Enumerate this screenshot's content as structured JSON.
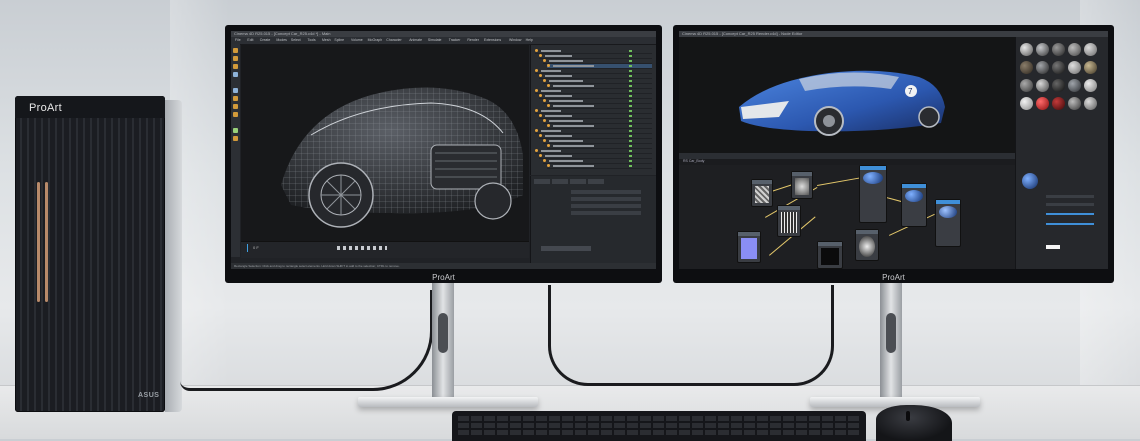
{
  "scene": {
    "tower": {
      "brand": "ProArt",
      "logo": "ASUS",
      "colors": {
        "body": "#1b1d22",
        "accent_slot": "#b88a6a",
        "side": "#c4c7cb"
      }
    },
    "monitor_left": {
      "bezel_logo": "ProArt",
      "app_title": "Cinema 4D R25.015 - [Concept Car_R25.c4d *] - Main",
      "menu_items": [
        "File",
        "Edit",
        "Create",
        "Modes",
        "Select",
        "Tools",
        "Mesh",
        "Spline",
        "Volume",
        "MoGraph",
        "Character",
        "Animate",
        "Simulate",
        "Tracker",
        "Render",
        "Extensions",
        "Window",
        "Help"
      ],
      "status_text": "Rectangle Selection: Click and drag to rectangle select elements. Hold down SHIFT to add to the selection; CTRL to remove.",
      "frame_readout": "0 F",
      "viewport_subject": "wireframe-car",
      "colors": {
        "ui_dark": "#202226",
        "accent": "#d29a3a",
        "tree_dot": "#e3a33e"
      }
    },
    "monitor_right": {
      "bezel_logo": "ProArt",
      "app_title": "Cinema 4D R25.015 - [Concept Car_R25 Render.c4d] - Node Editor",
      "viewport_subject": "rendered-blue-car",
      "car_number": "7",
      "node_panel_title": "RS Car_Body",
      "colors": {
        "car_body": "#2f5fbf",
        "wire": "#e2c66a",
        "node": "#3a3d43",
        "accent": "#3f8fd8"
      }
    },
    "peripherals": {
      "keyboard": "keyboard-icon",
      "mouse": "mouse-icon"
    }
  }
}
